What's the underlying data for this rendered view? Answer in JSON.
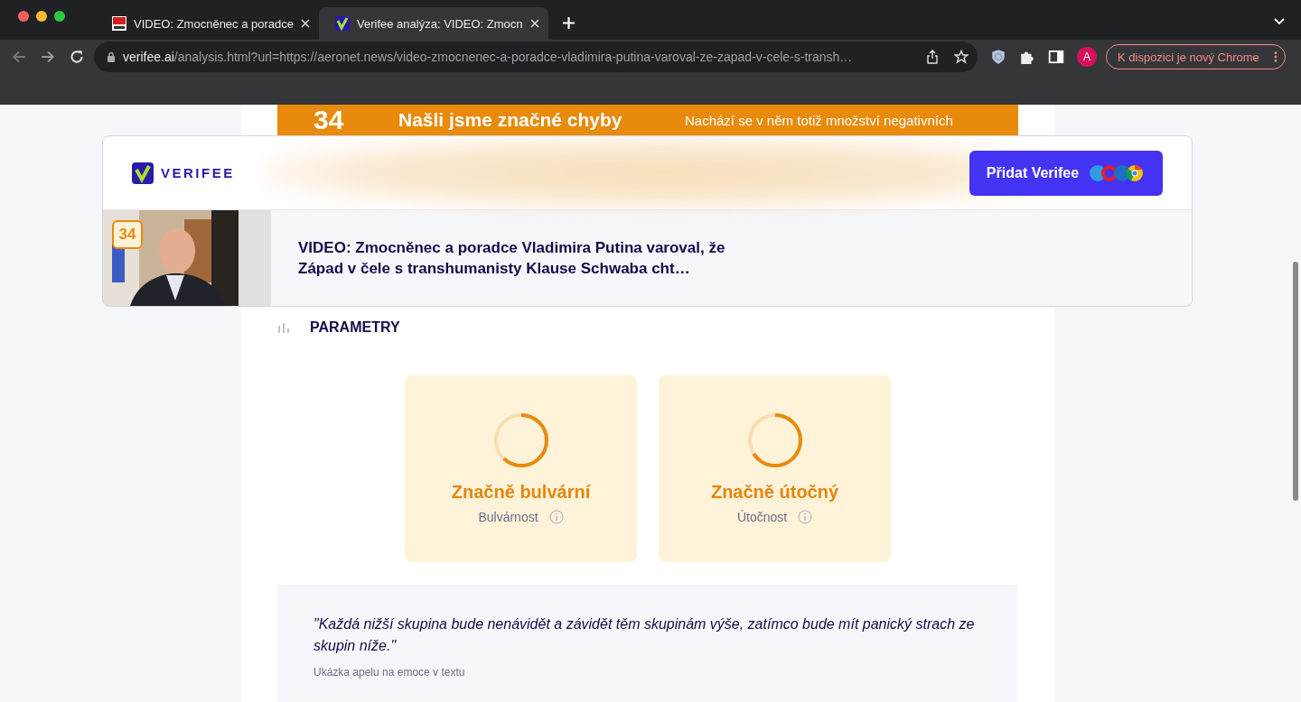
{
  "browser": {
    "tabs": [
      {
        "title": "VIDEO: Zmocněnec a poradce",
        "selected": false,
        "kind": "news"
      },
      {
        "title": "Verifee analýza: VIDEO: Zmocn",
        "selected": true,
        "kind": "verifee"
      }
    ],
    "url_host": "verifee.ai",
    "url_path": "/analysis.html?url=https://aeronet.news/video-zmocnenec-a-poradce-vladimira-putina-varoval-ze-zapad-v-cele-s-transh…",
    "avatar": "A",
    "update_button": "K dispozici je nový Chrome"
  },
  "banner": {
    "score": "34",
    "title": "Našli jsme značné chyby",
    "text": "Nachází se v něm totiž množství negativních"
  },
  "header": {
    "logo": "VERIFEE",
    "add_button": "Přidat Verifee",
    "article_score": "34",
    "article_title": "VIDEO: Zmocněnec a poradce Vladimira Putina varoval, že Západ v čele s transhumanisty Klause Schwaba cht…"
  },
  "parameters": {
    "heading": "PARAMETRY",
    "cards": [
      {
        "value": "Značně bulvární",
        "label": "Bulvárnost",
        "level": 0.62
      },
      {
        "value": "Značně útočný",
        "label": "Útočnost",
        "level": 0.66
      }
    ]
  },
  "quote": {
    "text": "\"Každá nižší skupina bude nenávidět a závidět těm skupinám výše, zatímco bude mít panický strach ze skupin níže.\"",
    "caption": "Ukázka apelu na emoce v textu"
  }
}
